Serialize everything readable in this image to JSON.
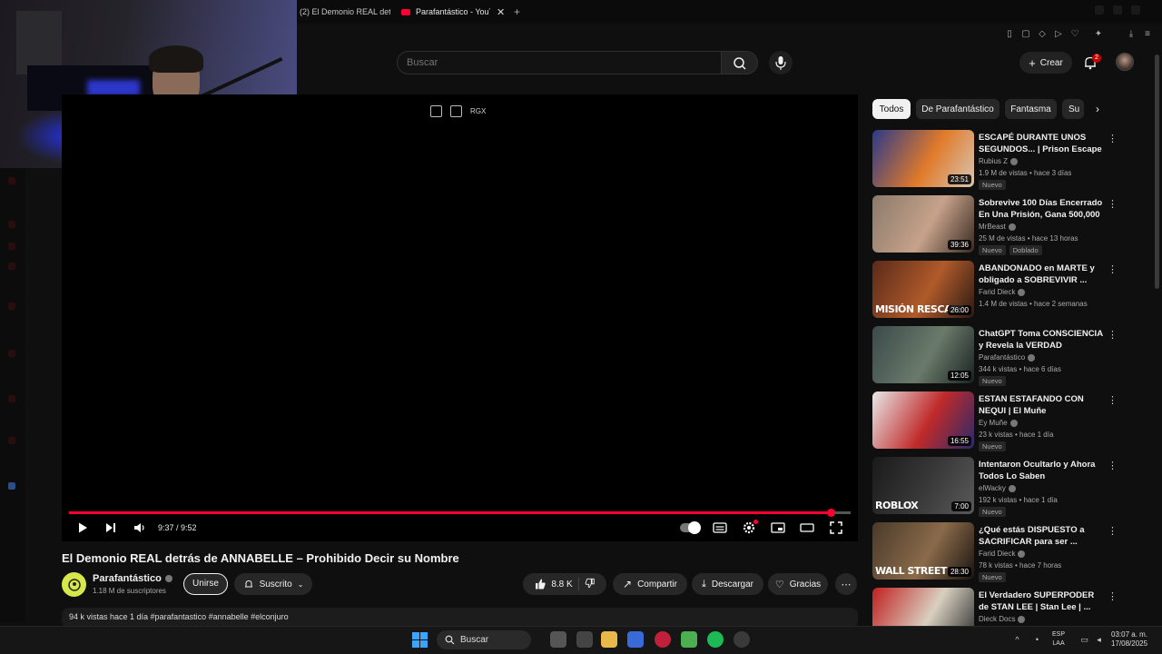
{
  "browser": {
    "tabs": [
      {
        "label": "(2) El Demonio REAL detr"
      },
      {
        "label": "Parafantástico - YouT"
      }
    ]
  },
  "search": {
    "placeholder": "Buscar"
  },
  "header": {
    "create_label": "Crear",
    "notification_count": "2"
  },
  "player": {
    "time": "9:37 / 9:52",
    "progress": 0.975,
    "overlay_badge": "RGX"
  },
  "video": {
    "title": "El Demonio REAL detrás de ANNABELLE – Prohibido Decir su Nombre",
    "channel": "Parafantástico",
    "subscribers": "1.18 M de suscriptores",
    "join_label": "Unirse",
    "subscribed_label": "Suscrito",
    "likes": "8.8 K",
    "share_label": "Compartir",
    "download_label": "Descargar",
    "thanks_label": "Gracias",
    "description": "94 k vistas  hace 1 día  #parafantastico #annabelle #elconjuro"
  },
  "chips": [
    {
      "label": "Todos",
      "active": true
    },
    {
      "label": "De Parafantástico",
      "active": false
    },
    {
      "label": "Fantasma",
      "active": false
    },
    {
      "label": "Su",
      "active": false
    }
  ],
  "recommended": [
    {
      "title": "ESCAPÉ DURANTE UNOS SEGUNDOS... | Prison Escape ...",
      "channel": "Rubius Z",
      "meta": "1.9 M de vistas • hace 3 días",
      "badges": [
        "Nuevo"
      ],
      "duration": "23:51",
      "thumb_text": "",
      "colors": [
        "#2b3a8a",
        "#e07a2a",
        "#d8c6b2"
      ]
    },
    {
      "title": "Sobrevive 100 Días Encerrado En Una Prisión, Gana 500,000 ...",
      "channel": "MrBeast",
      "meta": "25 M de vistas • hace 13 horas",
      "badges": [
        "Nuevo",
        "Doblado"
      ],
      "duration": "39:36",
      "thumb_text": "",
      "colors": [
        "#8a7a6a",
        "#c6a28a",
        "#3a2a22"
      ]
    },
    {
      "title": "ABANDONADO en MARTE y obligado a SOBREVIVIR ...",
      "channel": "Farid Dieck",
      "meta": "1.4 M de vistas • hace 2 semanas",
      "badges": [],
      "duration": "26:00",
      "thumb_text": "MISIÓN RESCATE",
      "colors": [
        "#5a2a1a",
        "#b05a2a",
        "#2a1a14"
      ]
    },
    {
      "title": "ChatGPT Toma CONSCIENCIA y Revela la VERDAD",
      "channel": "Parafantástico",
      "meta": "344 k vistas • hace 6 días",
      "badges": [
        "Nuevo"
      ],
      "duration": "12:05",
      "thumb_text": "",
      "colors": [
        "#3a4a4a",
        "#6a7a6a",
        "#1a2222"
      ]
    },
    {
      "title": "ESTAN ESTAFANDO CON NEQUI | El Muñe",
      "channel": "Ey Muñe",
      "meta": "23 k vistas • hace 1 día",
      "badges": [
        "Nuevo"
      ],
      "duration": "16:55",
      "thumb_text": "",
      "colors": [
        "#e8e8e8",
        "#c02a2a",
        "#2a2a6a"
      ]
    },
    {
      "title": "Intentaron Ocultarlo y Ahora Todos Lo Saben",
      "channel": "elWacky",
      "meta": "192 k vistas • hace 1 día",
      "badges": [
        "Nuevo"
      ],
      "duration": "7:00",
      "thumb_text": "ROBLOX",
      "colors": [
        "#1a1a1a",
        "#3a3a3a",
        "#5a5a5a"
      ]
    },
    {
      "title": "¿Qué estás DISPUESTO a SACRIFICAR para ser ...",
      "channel": "Farid Dieck",
      "meta": "78 k vistas • hace 7 horas",
      "badges": [
        "Nuevo"
      ],
      "duration": "28:30",
      "thumb_text": "WALL STREET",
      "colors": [
        "#4a3a2a",
        "#8a6a4a",
        "#1a1410"
      ]
    },
    {
      "title": "El Verdadero SUPERPODER de STAN LEE | Stan Lee | ...",
      "channel": "Dieck Docs",
      "meta": "",
      "badges": [],
      "duration": "",
      "thumb_text": "",
      "colors": [
        "#c02020",
        "#d8d0c0",
        "#2a2a2a"
      ]
    }
  ],
  "taskbar": {
    "search_label": "Buscar",
    "language": "ESP",
    "layout": "LAA",
    "time": "03:07 a. m.",
    "date": "17/08/2025"
  },
  "colors": {
    "accent": "#ff0033",
    "background": "#0f0f0f",
    "chip_active": "#f1f1f1"
  }
}
